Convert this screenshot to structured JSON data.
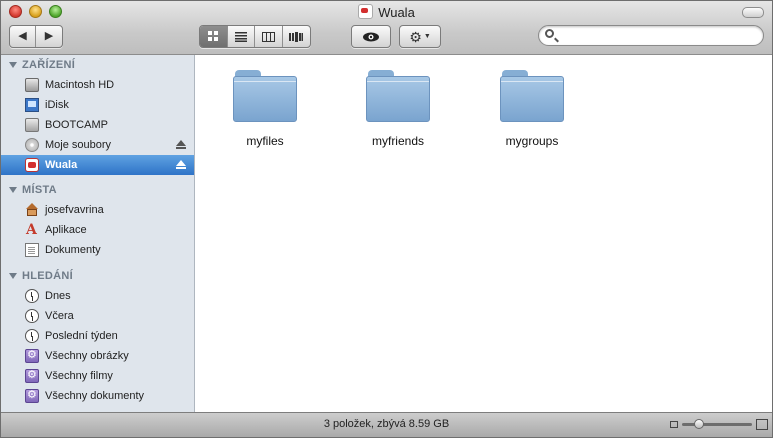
{
  "window": {
    "title": "Wuala"
  },
  "toolbar": {
    "back_icon": "◀",
    "forward_icon": "▶",
    "view_icons": [
      "icon-view-icon",
      "list-view-icon",
      "column-view-icon",
      "coverflow-view-icon"
    ],
    "quicklook_icon": "eye-icon",
    "action_icon": "gear-icon",
    "search": {
      "value": "",
      "placeholder": ""
    }
  },
  "sidebar": {
    "sections": [
      {
        "title": "ZAŘÍZENÍ",
        "items": [
          {
            "label": "Macintosh HD",
            "icon": "hard-drive-icon"
          },
          {
            "label": "iDisk",
            "icon": "idisk-icon"
          },
          {
            "label": "BOOTCAMP",
            "icon": "hard-drive-icon"
          },
          {
            "label": "Moje soubory",
            "icon": "disc-icon",
            "eject": true
          },
          {
            "label": "Wuala",
            "icon": "wuala-icon",
            "eject": true,
            "selected": true
          }
        ]
      },
      {
        "title": "MÍSTA",
        "items": [
          {
            "label": "josefvavrina",
            "icon": "home-icon"
          },
          {
            "label": "Aplikace",
            "icon": "applications-icon"
          },
          {
            "label": "Dokumenty",
            "icon": "documents-icon"
          }
        ]
      },
      {
        "title": "HLEDÁNÍ",
        "items": [
          {
            "label": "Dnes",
            "icon": "clock-icon"
          },
          {
            "label": "Včera",
            "icon": "clock-icon"
          },
          {
            "label": "Poslední týden",
            "icon": "clock-icon"
          },
          {
            "label": "Všechny obrázky",
            "icon": "smart-folder-icon"
          },
          {
            "label": "Všechny filmy",
            "icon": "smart-folder-icon"
          },
          {
            "label": "Všechny dokumenty",
            "icon": "smart-folder-icon"
          }
        ]
      }
    ]
  },
  "content": {
    "folders": [
      {
        "label": "myfiles",
        "icon": "folder-icon"
      },
      {
        "label": "myfriends",
        "icon": "folder-icon"
      },
      {
        "label": "mygroups",
        "icon": "folder-icon"
      }
    ]
  },
  "statusbar": {
    "text": "3 položek, zbývá 8.59 GB",
    "icon_size_level": 0.2
  }
}
